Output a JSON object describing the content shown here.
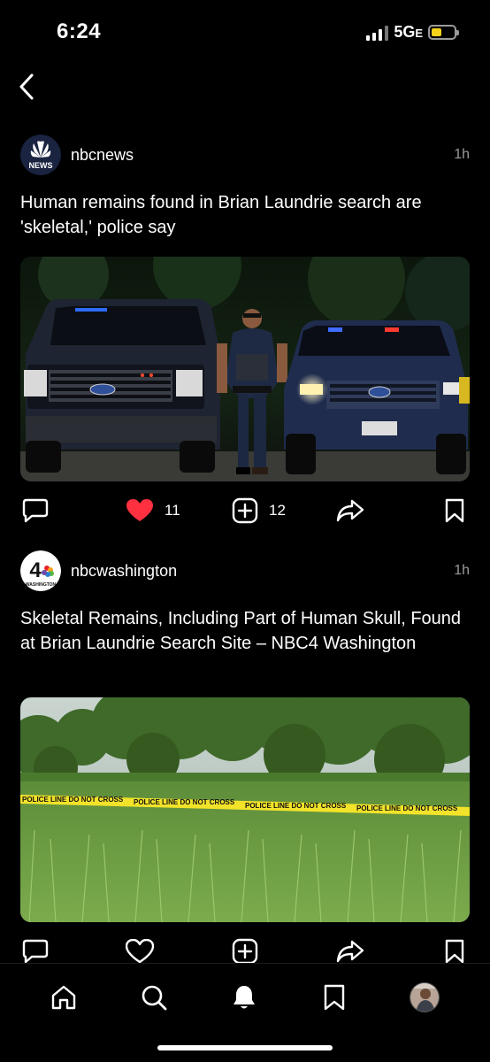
{
  "status_bar": {
    "time": "6:24",
    "network": "5G",
    "network_suffix": "E",
    "battery_color": "#f6d21b"
  },
  "posts": [
    {
      "account": "nbcnews",
      "avatar_icon": "nbc-news-peacock-icon",
      "avatar_text": "NEWS",
      "time": "1h",
      "headline": "Human remains found in Brian Laundrie search are 'skeletal,' police say",
      "image": "police-officer-with-two-police-vehicles",
      "liked": true,
      "like_count": "11",
      "repost_count": "12"
    },
    {
      "account": "nbcwashington",
      "avatar_icon": "nbc4-washington-logo",
      "avatar_text": "4",
      "avatar_subtext": "WASHINGTON",
      "time": "1h",
      "headline": "Skeletal Remains, Including Part of Human Skull, Found at Brian Laundrie Search Site – NBC4 Washington",
      "image": "police-tape-across-grass-field",
      "police_tape_text": "POLICE LINE DO NOT CROSS",
      "liked": false
    }
  ],
  "colors": {
    "background": "#000000",
    "like_red": "#ff3040",
    "secondary_text": "#9a9a9a",
    "tape_yellow": "#f2e32a"
  },
  "tab_bar": {
    "items": [
      "home-icon",
      "search-icon",
      "notifications-icon",
      "saved-icon",
      "profile-avatar"
    ],
    "active": "notifications-icon"
  }
}
